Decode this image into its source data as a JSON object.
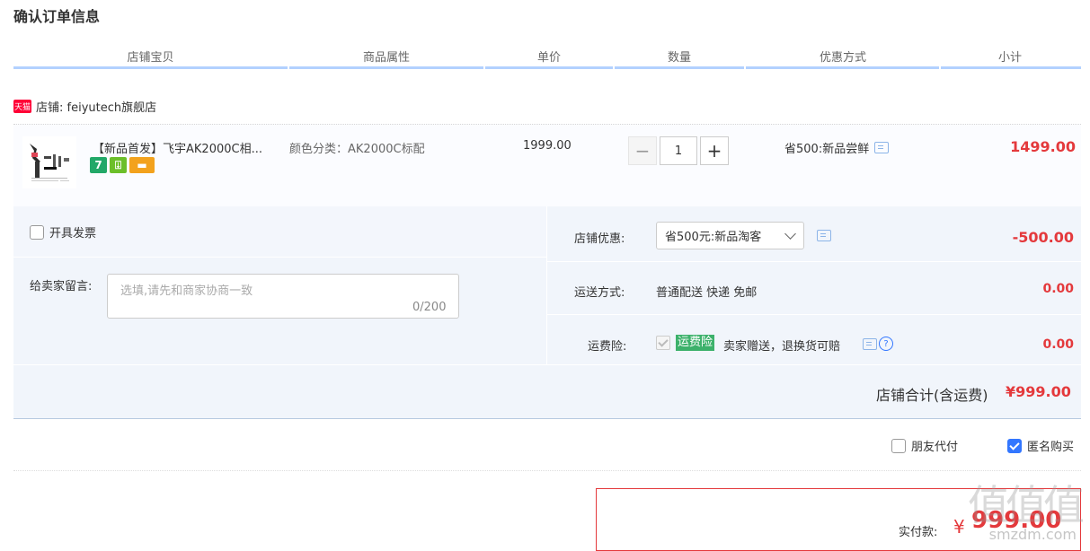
{
  "page": {
    "title": "确认订单信息"
  },
  "table_headers": [
    "店铺宝贝",
    "商品属性",
    "单价",
    "数量",
    "优惠方式",
    "小计"
  ],
  "shop": {
    "icon": "天猫",
    "name": "店铺: feiyutech旗舰店"
  },
  "item": {
    "title": "【新品首发】飞宇AK2000C相...",
    "attribute": "颜色分类：AK2000C标配",
    "unit_price": "1999.00",
    "quantity": "1",
    "promotion": "省500:新品尝鲜",
    "subtotal": "1499.00",
    "badges": [
      "7",
      "⍗",
      "▬"
    ]
  },
  "options": {
    "invoice_label": "开具发票",
    "message_label": "给卖家留言:",
    "message_placeholder": "选填,请先和商家协商一致",
    "message_count": "0/200",
    "shop_discount_label": "店铺优惠:",
    "shop_discount_value": "省500元:新品淘客",
    "shop_discount_amount": "-500.00",
    "shipping_label": "运送方式:",
    "shipping_value": "普通配送 快递 免邮",
    "shipping_amount": "0.00",
    "insurance_label": "运费险:",
    "insurance_tag": "运费险",
    "insurance_text": "卖家赠送，退换货可赔",
    "insurance_amount": "0.00",
    "help_glyph": "?"
  },
  "shop_total": {
    "label": "店铺合计(含运费)",
    "value": "¥999.00"
  },
  "extras": {
    "friend_pay": "朋友代付",
    "anonymous": "匿名购买"
  },
  "payment": {
    "label": "实付款:",
    "currency": "¥",
    "value": "999.00"
  },
  "watermark": {
    "chars": "值值值",
    "site": "smzdm.com"
  },
  "colors": {
    "accent": "#e4393c",
    "header_bar": "#b2d1ff",
    "panel_bg": "#f1f5fb",
    "checkbox_blue": "#3377ff",
    "insurance_green": "#3cb16b"
  }
}
